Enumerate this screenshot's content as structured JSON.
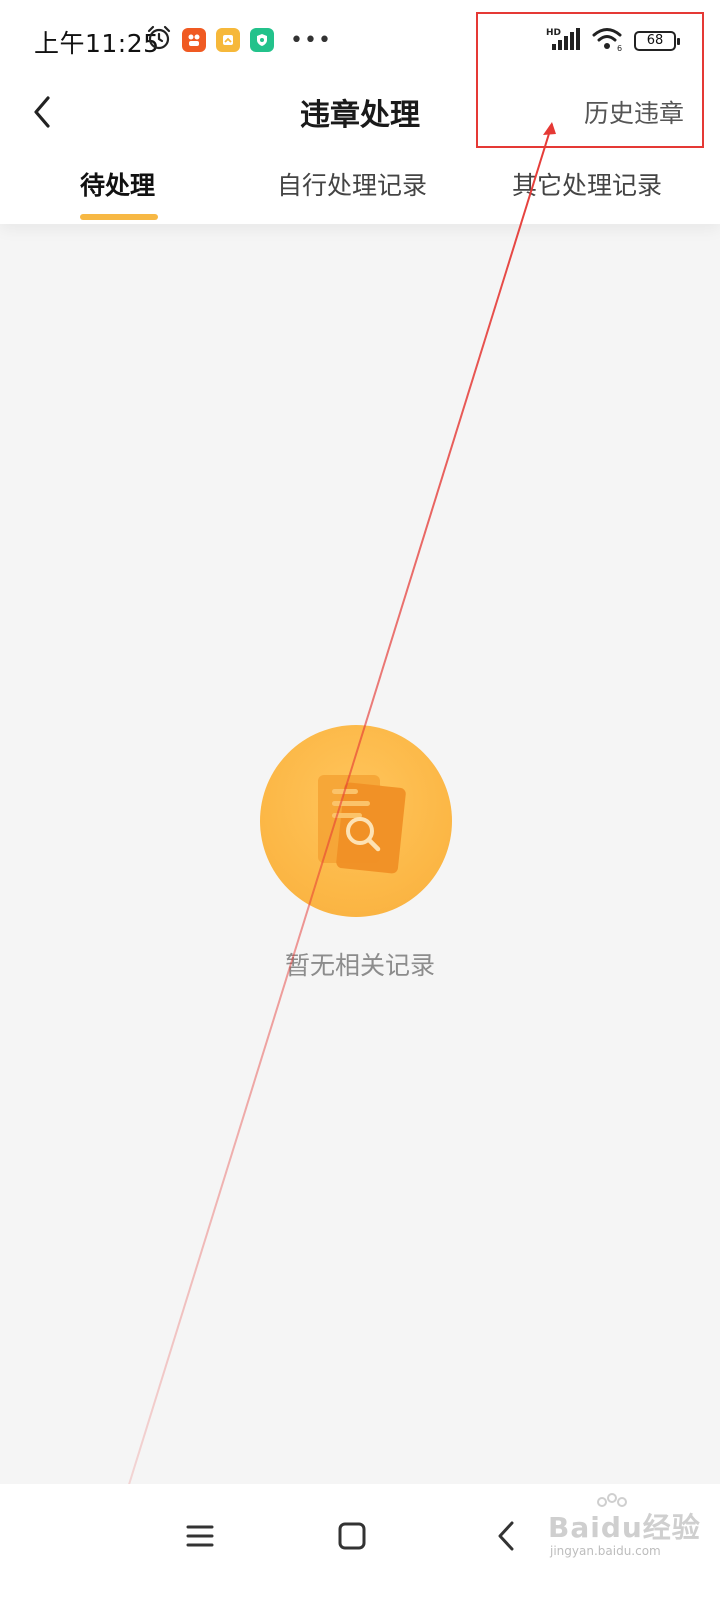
{
  "status_bar": {
    "time": "上午11:25",
    "signal_label": "HD",
    "wifi_label": "6",
    "battery": "68"
  },
  "header": {
    "title": "违章处理",
    "history_link": "历史违章"
  },
  "tabs": [
    {
      "label": "待处理",
      "active": true
    },
    {
      "label": "自行处理记录",
      "active": false
    },
    {
      "label": "其它处理记录",
      "active": false
    }
  ],
  "empty_state": {
    "message": "暂无相关记录"
  },
  "watermark": {
    "brand": "Baidu经验",
    "url": "jingyan.baidu.com"
  },
  "colors": {
    "accent": "#f7b844",
    "annotation": "#e53935"
  }
}
